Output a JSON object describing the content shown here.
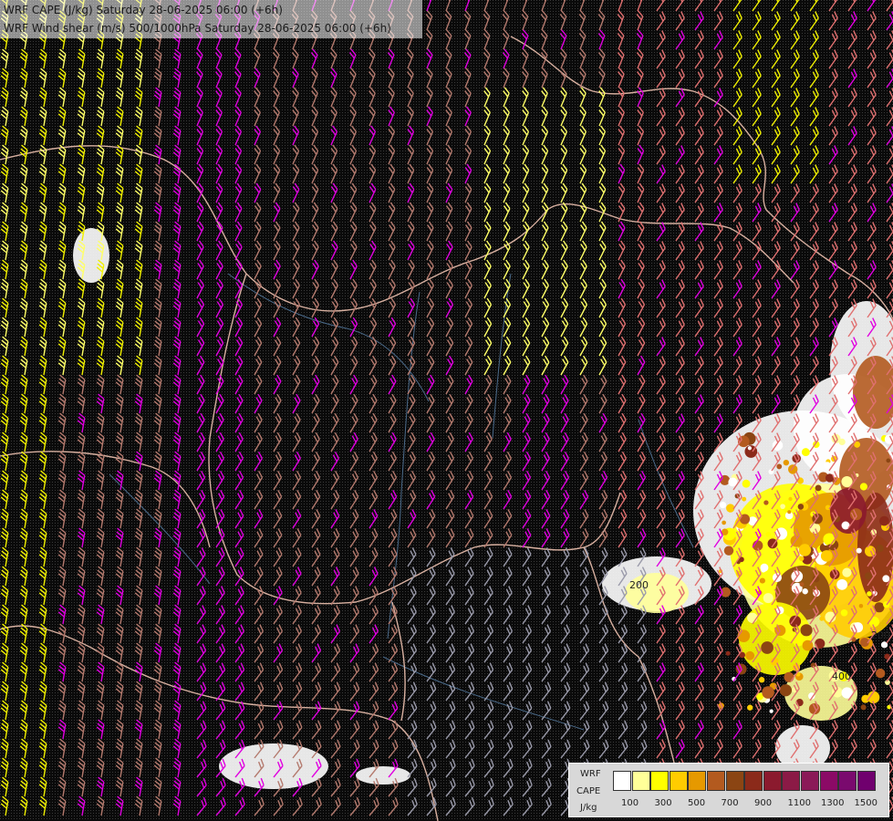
{
  "header": {
    "line1": "WRF CAPE (J/kg) Saturday 28-06-2025 06:00 (+6h)",
    "line2": "WRF Wind shear (m/s) 500/1000hPa Saturday 28-06-2025 06:00 (+6h)"
  },
  "legend": {
    "model": "WRF",
    "field": "CAPE",
    "unit": "J/kg",
    "ticks": [
      "100",
      "300",
      "500",
      "700",
      "900",
      "1100",
      "1300",
      "1500"
    ],
    "colors": [
      "#ffffff",
      "#ffff99",
      "#ffff00",
      "#ffcc00",
      "#e69900",
      "#b35a1f",
      "#8b4513",
      "#8b2a1a",
      "#8b1a2e",
      "#8b1a46",
      "#8b1a58",
      "#8b0a66",
      "#7a0a6e",
      "#70006e"
    ]
  },
  "map": {
    "contour_labels": [
      "200",
      "400",
      "200"
    ],
    "barb_colors": {
      "yellow": "#f0f000",
      "light_yellow": "#ffff66",
      "magenta": "#e000e0",
      "salmon": "#e07070",
      "brown": "#b47a6e",
      "grey": "#9a9aaa"
    },
    "border_color": "#d8b0a0",
    "river_color": "#4a6a8a"
  }
}
